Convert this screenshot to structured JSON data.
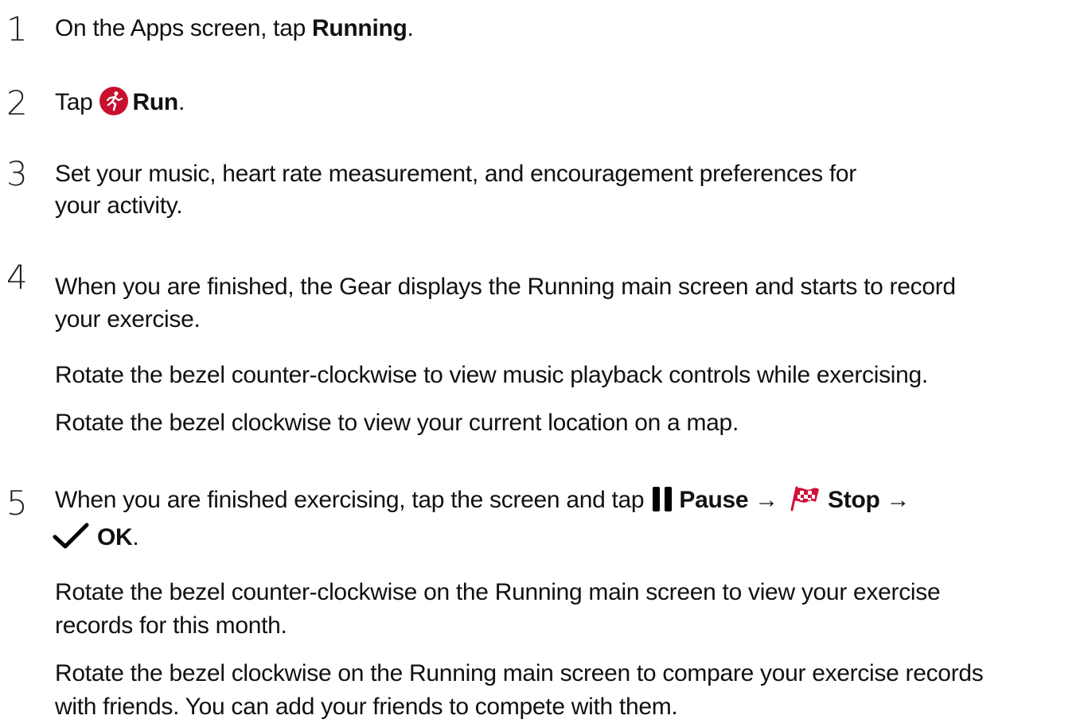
{
  "steps": [
    {
      "num": "1",
      "pre": "On the Apps screen, tap ",
      "bold": "Running",
      "post": "."
    },
    {
      "num": "2",
      "pre": "Tap ",
      "icon": "run-icon",
      "bold": "Run",
      "post": "."
    },
    {
      "num": "3",
      "line1": "Set your music, heart rate measurement, and encouragement preferences for",
      "line2": "your activity."
    },
    {
      "num": "4",
      "line1": "When you are finished, the Gear displays the Running main screen and starts to record",
      "line2": "your exercise.",
      "para1": "Rotate the bezel counter-clockwise to view music playback controls while exercising.",
      "para2": "Rotate the bezel clockwise to view your current location on a map."
    },
    {
      "num": "5",
      "pre": "When you are finished exercising, tap the screen and tap ",
      "pause_icon": "pause-icon",
      "pause_label": "Pause",
      "arrow1": " →",
      "stop_icon": "checkered-flag-icon",
      "stop_label": "Stop",
      "arrow2": " →",
      "ok_icon": "checkmark-icon",
      "ok_label": "OK",
      "ok_post": ".",
      "para1_line1": "Rotate the bezel counter-clockwise on the Running main screen to view your exercise",
      "para1_line2": "records for this month.",
      "para2_line1": "Rotate the bezel clockwise on the Running main screen to compare your exercise records",
      "para2_line2": "with friends. You can add your friends to compete with them."
    }
  ],
  "colors": {
    "run_icon_bg": "#c8102e",
    "flag_red": "#d0103a",
    "text": "#111111"
  }
}
